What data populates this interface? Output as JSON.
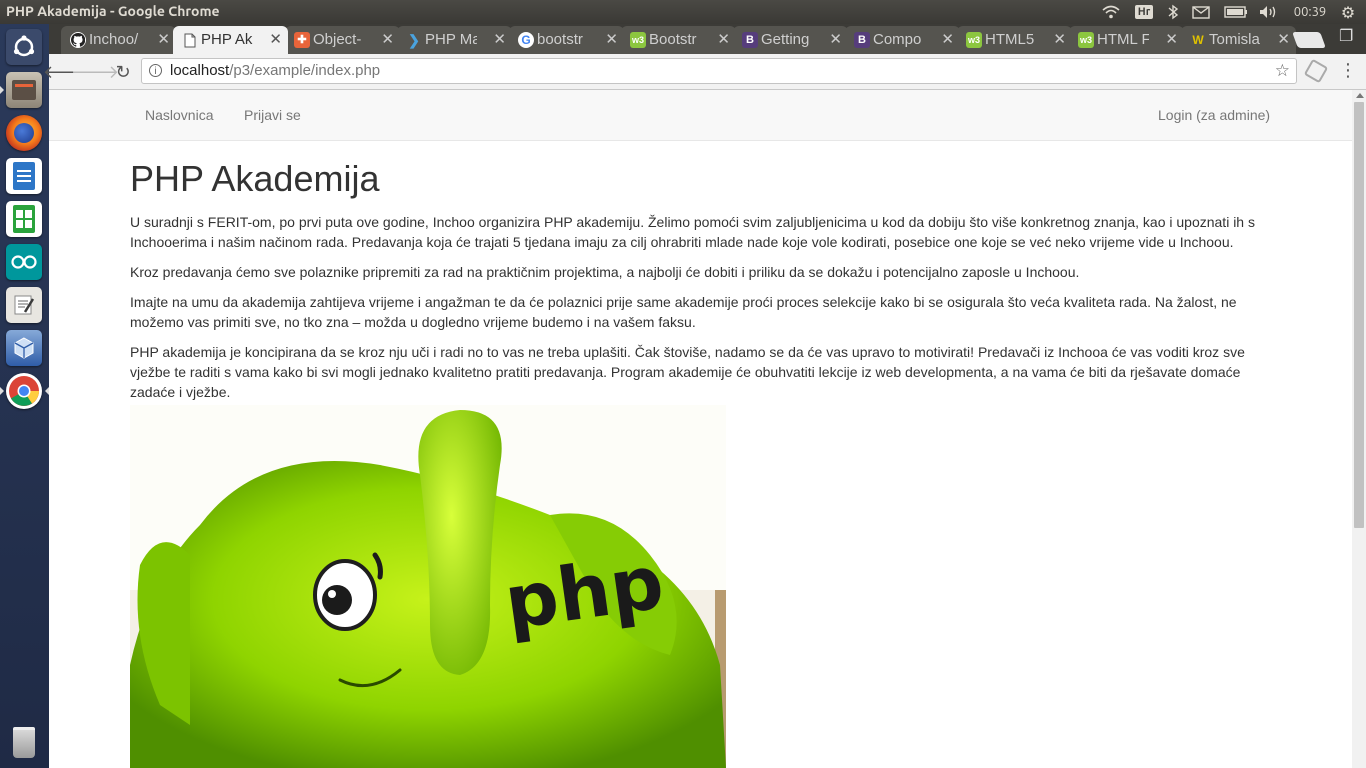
{
  "os": {
    "window_title": "PHP Akademija - Google Chrome",
    "keyboard_layout": "Hr",
    "clock": "00:39",
    "launcher_icons": [
      "ubuntu-dash-icon",
      "files-icon",
      "firefox-icon",
      "writer-icon",
      "calc-icon",
      "arduino-icon",
      "text-editor-icon",
      "virtualbox-icon",
      "chrome-icon",
      "trash-icon"
    ]
  },
  "browser": {
    "tabs": [
      {
        "label": "Inchoo/",
        "favicon": "github-icon",
        "active": false
      },
      {
        "label": "PHP Ak",
        "favicon": "page-icon",
        "active": true
      },
      {
        "label": "Object-",
        "favicon": "plus-icon",
        "active": false
      },
      {
        "label": "PHP Ma",
        "favicon": "php-mirror-icon",
        "active": false
      },
      {
        "label": "bootstr",
        "favicon": "google-icon",
        "active": false
      },
      {
        "label": "Bootstr",
        "favicon": "w3-icon",
        "active": false
      },
      {
        "label": "Getting",
        "favicon": "bootstrap-icon",
        "active": false
      },
      {
        "label": "Compo",
        "favicon": "bootstrap-icon",
        "active": false
      },
      {
        "label": "HTML5",
        "favicon": "w3-icon",
        "active": false
      },
      {
        "label": "HTML F",
        "favicon": "w3-icon",
        "active": false
      },
      {
        "label": "Tomisla",
        "favicon": "w-icon",
        "active": false
      }
    ],
    "url_host": "localhost",
    "url_path": "/p3/example/index.php"
  },
  "page": {
    "nav": {
      "home": "Naslovnica",
      "signup": "Prijavi se",
      "login": "Login (za admine)"
    },
    "title": "PHP Akademija",
    "paragraphs": [
      "U suradnji s FERIT-om, po prvi puta ove godine, Inchoo organizira PHP akademiju. Želimo pomoći svim zaljubljenicima u kod da dobiju što više konkretnog znanja, kao i upoznati ih s Inchooerima i našim načinom rada. Predavanja koja će trajati 5 tjedana imaju za cilj ohrabriti mlade nade koje vole kodirati, posebice one koje se već neko vrijeme vide u Inchoou.",
      "Kroz predavanja ćemo sve polaznike pripremiti za rad na praktičnim projektima, a najbolji će dobiti i priliku da se dokažu i potencijalno zaposle u Inchoou.",
      "Imajte na umu da akademija zahtijeva vrijeme i angažman te da će polaznici prije same akademije proći proces selekcije kako bi se osigurala što veća kvaliteta rada. Na žalost, ne možemo vas primiti sve, no tko zna – možda u dogledno vrijeme budemo i na vašem faksu.",
      "PHP akademija je koncipirana da se kroz nju uči i radi no to vas ne treba uplašiti. Čak štoviše, nadamo se da će vas upravo to motivirati! Predavači iz Inchooa će vas voditi kroz sve vježbe te raditi s vama kako bi svi mogli jednako kvalitetno pratiti predavanja. Program akademije će obuhvatiti lekcije iz web developmenta, a na vama će biti da rješavate domaće zadaće i vježbe."
    ],
    "image_label": "php"
  },
  "colors": {
    "elephant_green": "#8fd400",
    "navbar_bg": "#f8f8f8",
    "link_gray": "#777777",
    "panel_bg": "#3c3b37"
  }
}
